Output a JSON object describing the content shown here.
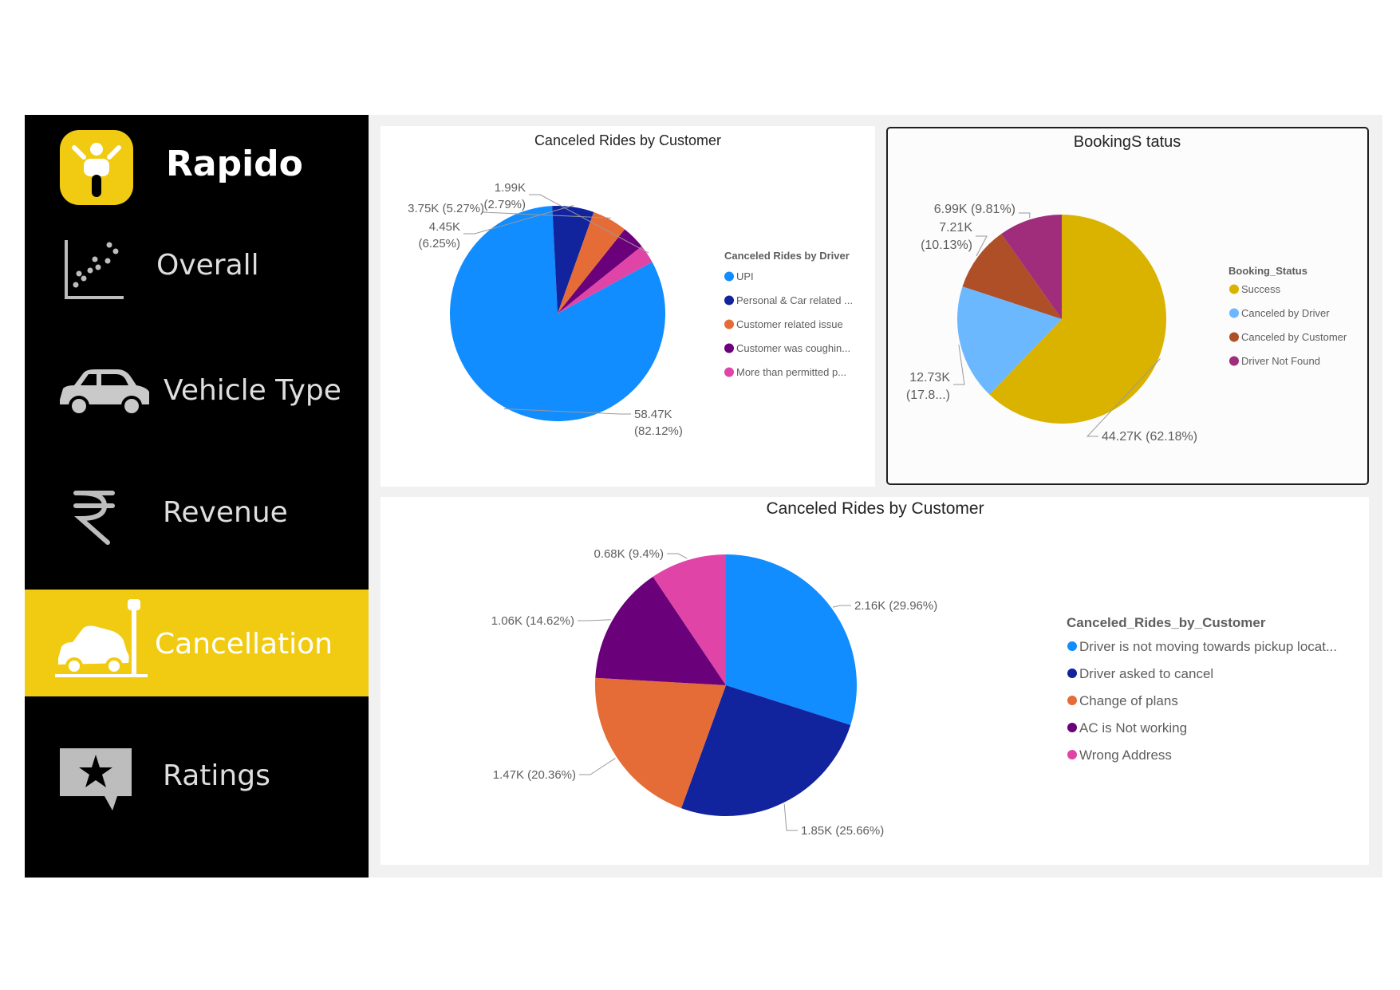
{
  "sidebar": {
    "brand": "Rapido",
    "items": [
      {
        "label": "Overall"
      },
      {
        "label": "Vehicle Type"
      },
      {
        "label": "Revenue"
      },
      {
        "label": "Cancellation"
      },
      {
        "label": "Ratings"
      }
    ],
    "active": "Cancellation",
    "accent_color": "#f1cb12"
  },
  "chart_data": [
    {
      "type": "pie",
      "title": "Canceled Rides by Customer",
      "legend_title": "Canceled Rides by Driver",
      "legend_placement": "right",
      "slices": [
        {
          "label": "UPI",
          "value": 58.47,
          "display": [
            "58.47K",
            "(82.12%)"
          ],
          "color": "#118dff"
        },
        {
          "label": "Personal & Car related ...",
          "value": 4.45,
          "display": [
            "4.45K",
            "(6.25%)"
          ],
          "color": "#12239e"
        },
        {
          "label": "Customer related issue",
          "value": 3.75,
          "display": [
            "3.75K (5.27%)"
          ],
          "color": "#e66c37"
        },
        {
          "label": "Customer was coughin...",
          "value": 2.52,
          "display": [],
          "color": "#6b007b"
        },
        {
          "label": "More than permitted p...",
          "value": 1.99,
          "display": [
            "1.99K",
            "(2.79%)"
          ],
          "color": "#e044a7"
        }
      ]
    },
    {
      "type": "pie",
      "title": "BookingS tatus",
      "legend_title": "Booking_Status",
      "legend_placement": "right",
      "slices": [
        {
          "label": "Success",
          "value": 44.27,
          "display": [
            "44.27K (62.18%)"
          ],
          "color": "#d9b300"
        },
        {
          "label": "Canceled by Driver",
          "value": 12.73,
          "display": [
            "12.73K",
            "(17.8...)"
          ],
          "color": "#6cb8ff"
        },
        {
          "label": "Canceled by Customer",
          "value": 7.21,
          "display": [
            "7.21K",
            "(10.13%)"
          ],
          "color": "#ae4f27"
        },
        {
          "label": "Driver Not Found",
          "value": 6.99,
          "display": [
            "6.99K (9.81%)"
          ],
          "color": "#a02d7c"
        }
      ]
    },
    {
      "type": "pie",
      "title": "Canceled Rides by Customer",
      "legend_title": "Canceled_Rides_by_Customer",
      "legend_placement": "right",
      "slices": [
        {
          "label": "Driver is not moving towards pickup locat...",
          "value": 2.16,
          "display": [
            "2.16K (29.96%)"
          ],
          "color": "#118dff"
        },
        {
          "label": "Driver asked to cancel",
          "value": 1.85,
          "display": [
            "1.85K (25.66%)"
          ],
          "color": "#12239e"
        },
        {
          "label": "Change of plans",
          "value": 1.47,
          "display": [
            "1.47K (20.36%)"
          ],
          "color": "#e66c37"
        },
        {
          "label": "AC is Not working",
          "value": 1.06,
          "display": [
            "1.06K (14.62%)"
          ],
          "color": "#6b007b"
        },
        {
          "label": "Wrong Address",
          "value": 0.68,
          "display": [
            "0.68K (9.4%)"
          ],
          "color": "#e044a7"
        }
      ]
    }
  ]
}
